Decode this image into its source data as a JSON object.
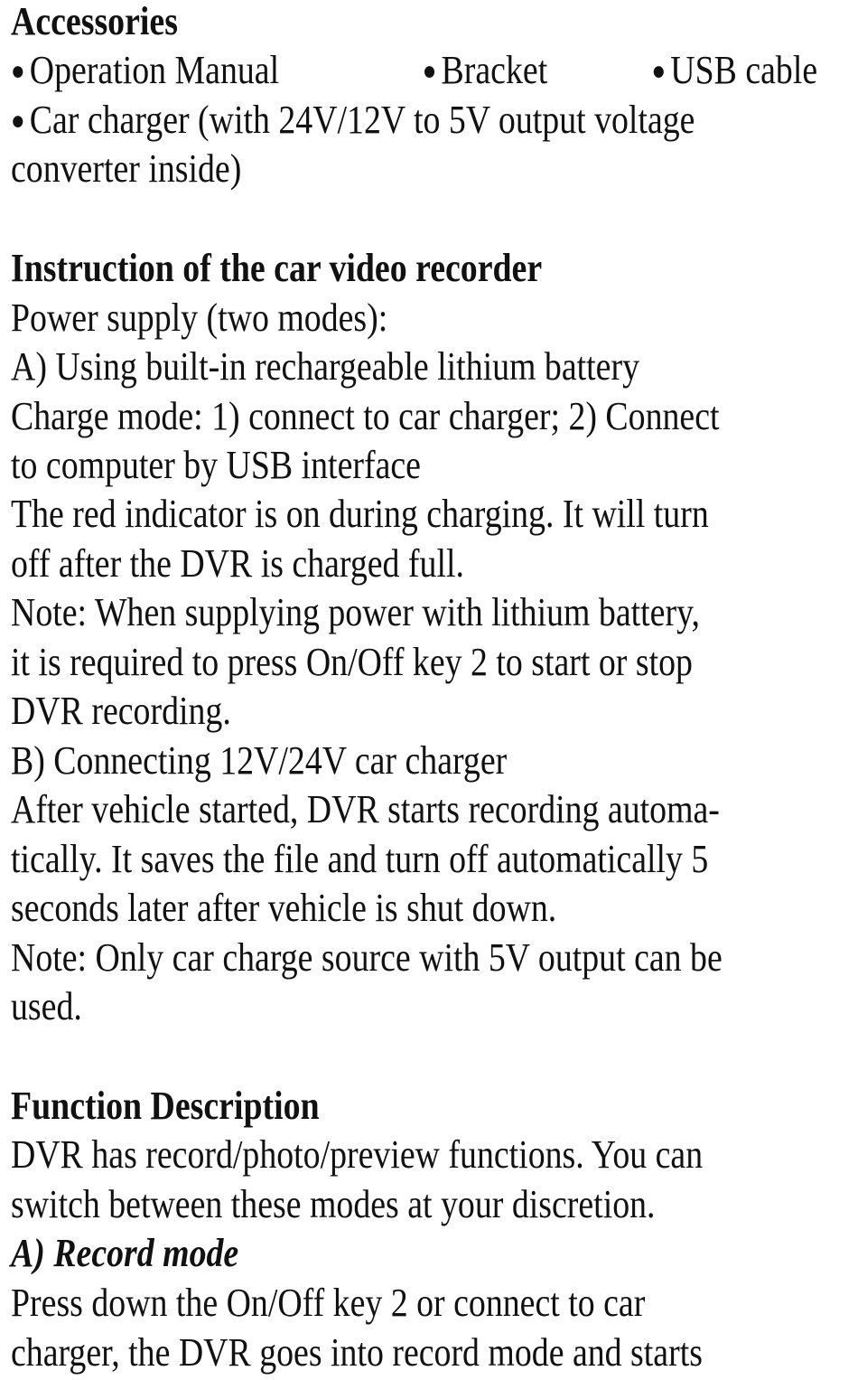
{
  "accessories": {
    "heading": "Accessories",
    "items": [
      "Operation Manual",
      "Bracket",
      "USB cable"
    ],
    "charger_line1": "Car charger (with 24V/12V to 5V output voltage",
    "charger_line2": "converter inside)",
    "bullet_glyph": "●"
  },
  "instruction": {
    "heading": "Instruction of the car video recorder",
    "lines": [
      "Power supply (two modes):",
      "A) Using built-in rechargeable lithium battery",
      "Charge mode: 1) connect to car charger; 2) Connect",
      "to computer by USB interface",
      "The red indicator is on during charging. It will turn",
      "off after the DVR is charged full.",
      "Note: When supplying power with lithium battery,",
      "it is required to press On/Off key 2 to start or stop",
      "DVR recording.",
      "B) Connecting 12V/24V car charger",
      "After vehicle started, DVR starts recording automa-",
      "tically. It saves the file and turn off automatically 5",
      "seconds later after vehicle is shut down.",
      "Note: Only car charge source with 5V output can be",
      "used."
    ]
  },
  "function": {
    "heading": "Function Description",
    "lines": [
      "DVR has record/photo/preview functions. You can",
      "switch between these modes at your discretion."
    ],
    "subheading": "A) Record mode",
    "record_lines": [
      "Press down the On/Off key 2 or connect to car",
      "charger, the DVR goes into record mode and starts"
    ]
  }
}
